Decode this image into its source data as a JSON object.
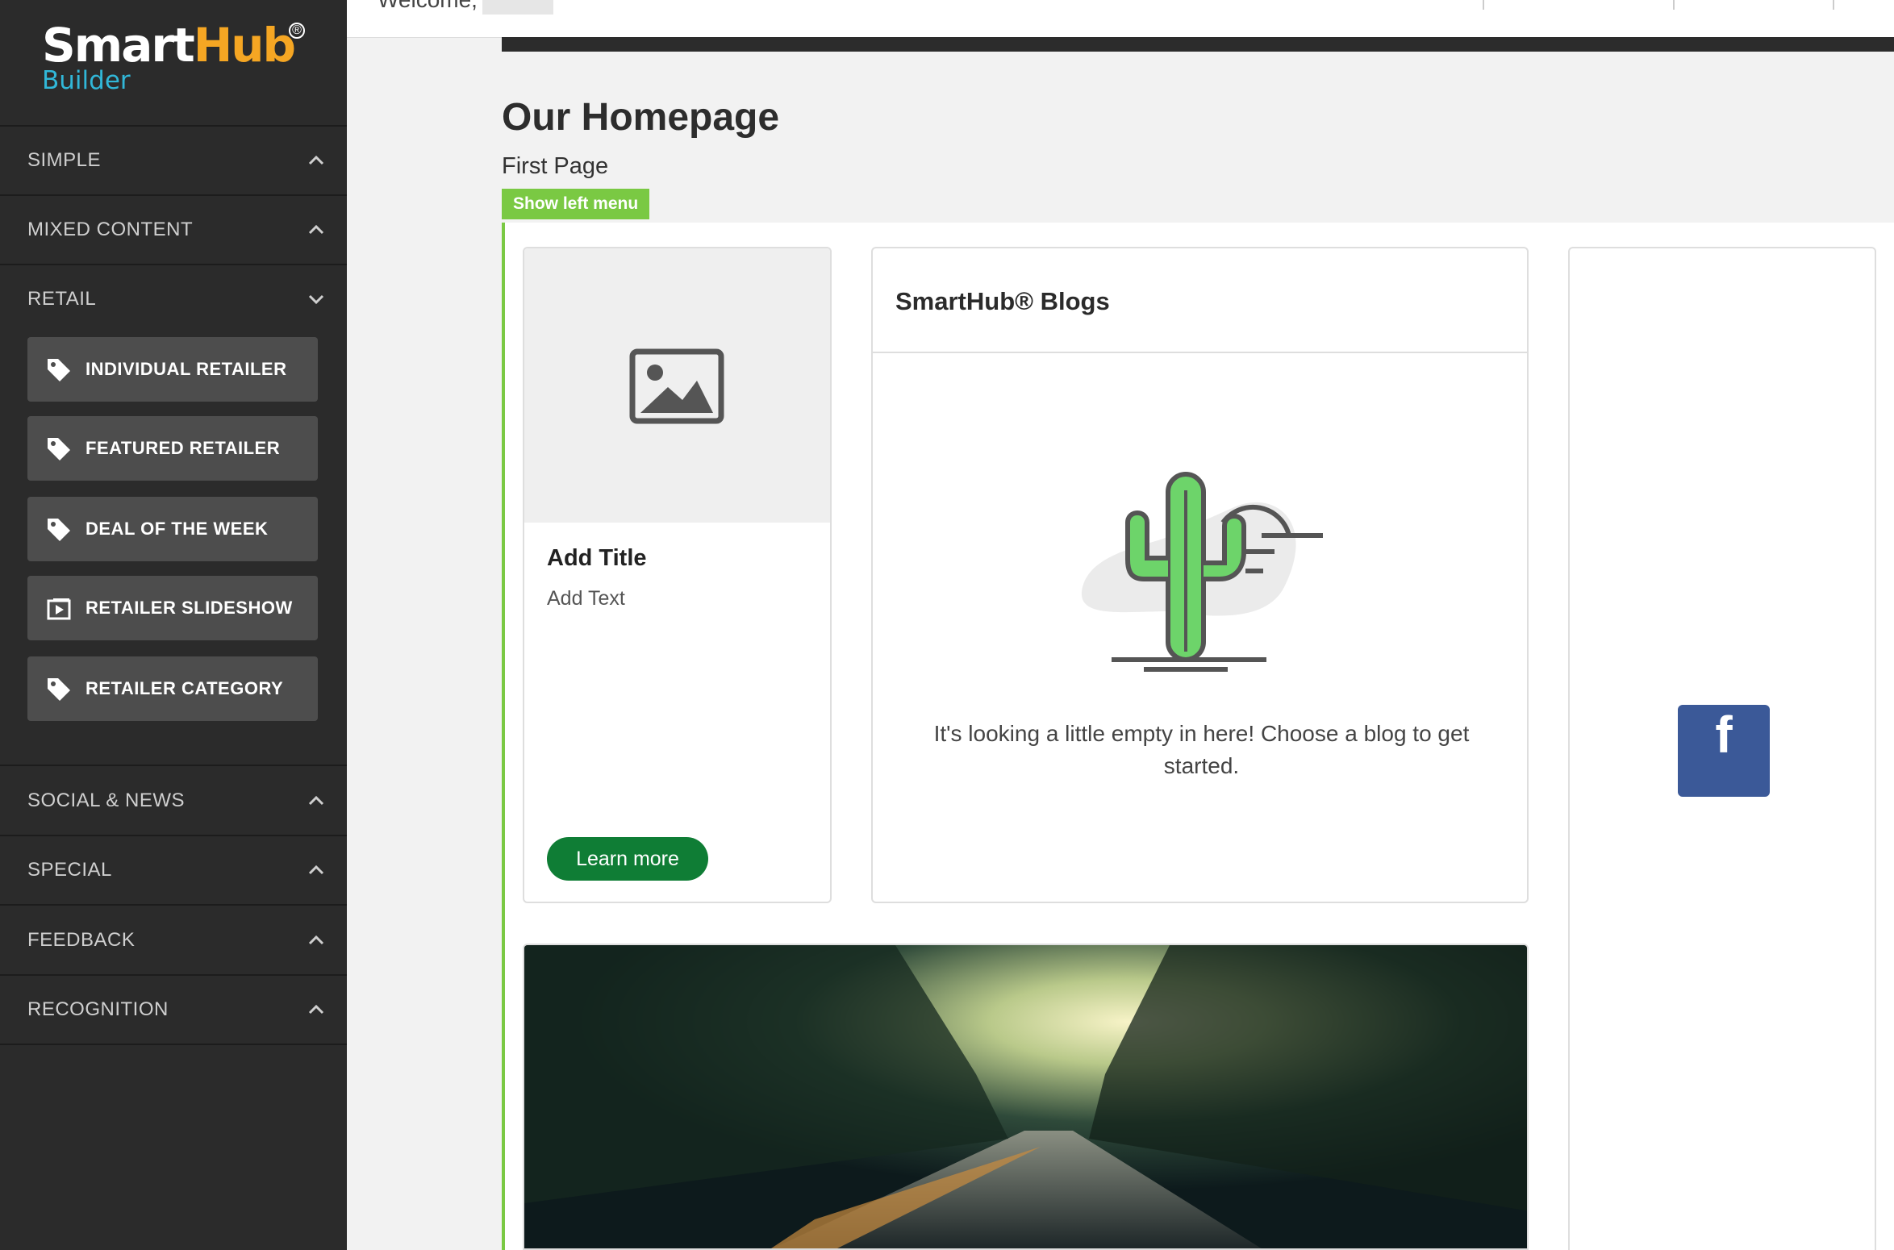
{
  "logo": {
    "smart": "Smart",
    "hub": "Hub",
    "registered": "®",
    "sub": "Builder"
  },
  "sidebar": {
    "sections": [
      {
        "label": "SIMPLE",
        "state": "collapsed"
      },
      {
        "label": "MIXED CONTENT",
        "state": "collapsed"
      },
      {
        "label": "RETAIL",
        "state": "expanded"
      },
      {
        "label": "SOCIAL & NEWS",
        "state": "collapsed"
      },
      {
        "label": "SPECIAL",
        "state": "collapsed"
      },
      {
        "label": "FEEDBACK",
        "state": "collapsed"
      },
      {
        "label": "RECOGNITION",
        "state": "collapsed"
      }
    ],
    "retail_items": [
      {
        "label": "INDIVIDUAL RETAILER",
        "icon": "tag-icon"
      },
      {
        "label": "FEATURED RETAILER",
        "icon": "tag-icon"
      },
      {
        "label": "DEAL OF THE WEEK",
        "icon": "tag-icon"
      },
      {
        "label": "RETAILER SLIDESHOW",
        "icon": "slideshow-icon"
      },
      {
        "label": "RETAILER CATEGORY",
        "icon": "tag-icon"
      }
    ]
  },
  "topbar": {
    "welcome": "Welcome,"
  },
  "page": {
    "title": "Our Homepage",
    "subtitle": "First Page",
    "show_left_menu": "Show left menu"
  },
  "widgets": {
    "content_card": {
      "title": "Add Title",
      "text": "Add Text",
      "button": "Learn more"
    },
    "blogs": {
      "title": "SmartHub® Blogs",
      "empty_message": "It's looking a little empty in here! Choose a blog to get started."
    },
    "facebook": {
      "glyph": "f"
    }
  },
  "colors": {
    "sidebar_bg": "#2b2b2b",
    "accent_green": "#7ac943",
    "button_green": "#0f7d35",
    "facebook_blue": "#3b5998",
    "logo_orange": "#f5a623",
    "logo_blue": "#31b7d8"
  }
}
